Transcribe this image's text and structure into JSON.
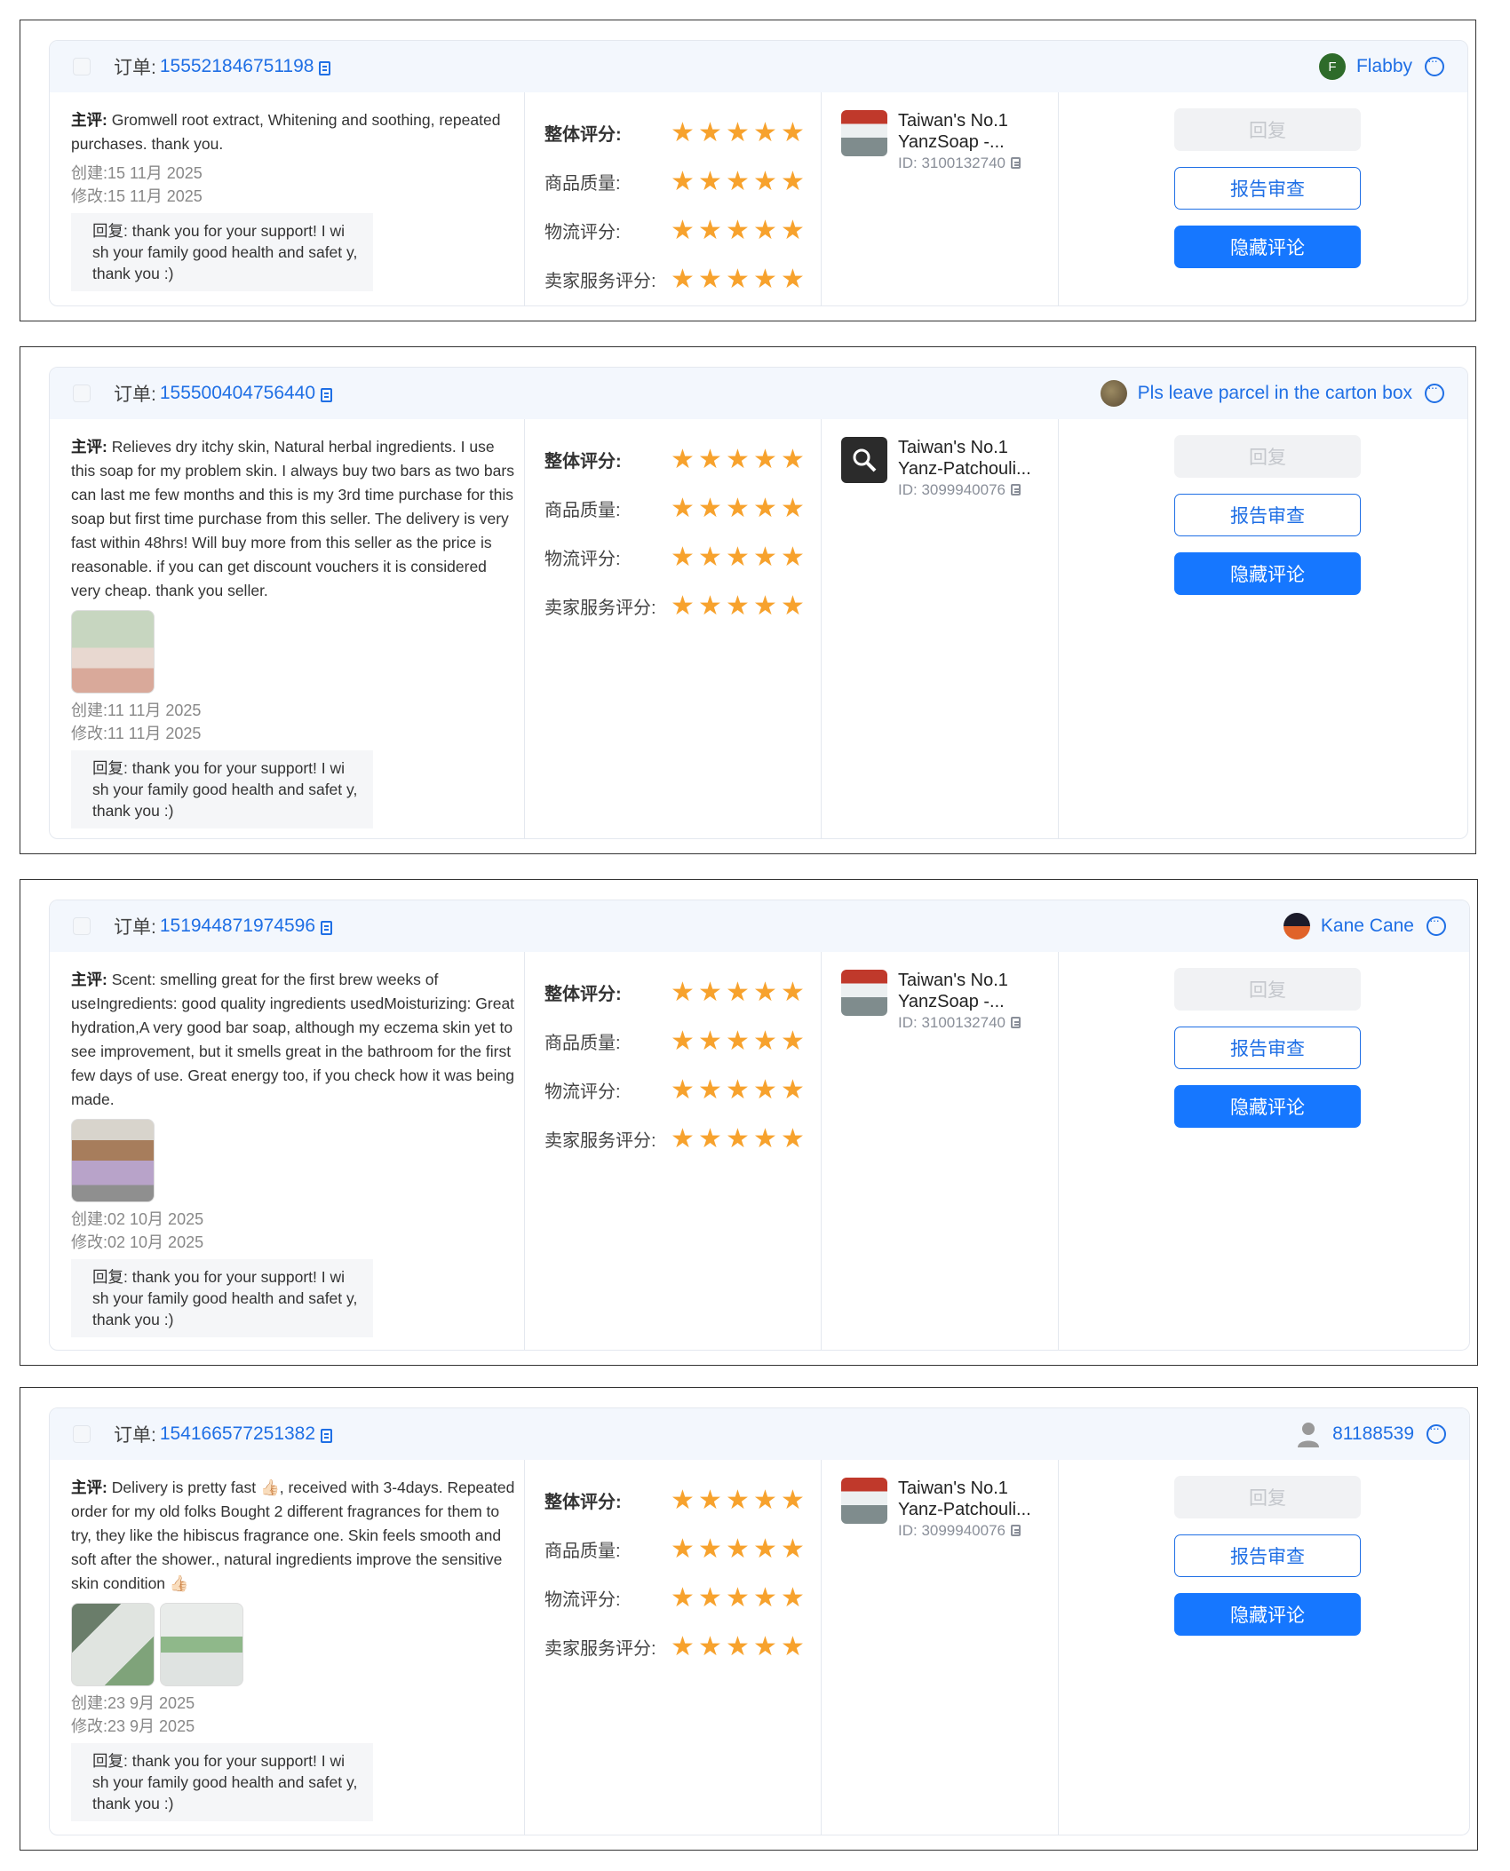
{
  "labels": {
    "order_prefix": "订单:",
    "main_review_prefix": "主评:",
    "created_prefix": "创建:",
    "modified_prefix": "修改:",
    "reply_prefix": "回复",
    "overall": "整体评分:",
    "quality": "商品质量:",
    "logistics": "物流评分:",
    "service": "卖家服务评分:",
    "btn_reply": "回复",
    "btn_report": "报告审查",
    "btn_hide": "隐藏评论",
    "star_glyph": "★"
  },
  "colors": {
    "accent": "#1677ff",
    "link": "#1f6fe5",
    "star": "#f7a22d",
    "header_bg": "#f3f7fd"
  },
  "reviews": [
    {
      "order_no": "155521846751198",
      "buyer": "Flabby",
      "buyer_avatar_letter": "F",
      "review": "Gromwell root extract, Whitening and soothing, repeated purchases. thank you.",
      "created": "15 11月 2025",
      "modified": "15 11月 2025",
      "reply": ": thank you for your support! I wi sh your family good health and safet y, thank you :)",
      "ratings": {
        "overall": 5,
        "quality": 5,
        "logistics": 5,
        "service": 5
      },
      "product_title_1": "Taiwan's No.1",
      "product_title_2": "YanzSoap -...",
      "product_id": "ID: 3100132740",
      "images": 0
    },
    {
      "order_no": "155500404756440",
      "buyer": "Pls leave parcel in the carton box",
      "buyer_avatar_letter": "",
      "review": "Relieves dry itchy skin, Natural herbal ingredients. I use this soap for my problem skin. I always buy two bars as two bars can last me few months and this is my 3rd time purchase for this soap but first time purchase from this seller. The delivery is very fast within 48hrs! Will buy more from this seller as the price is reasonable. if you can get discount vouchers it is considered very cheap. thank you seller.",
      "created": "11 11月 2025",
      "modified": "11 11月 2025",
      "reply": ": thank you for your support! I wi sh your family good health and safet y, thank you :)",
      "ratings": {
        "overall": 5,
        "quality": 5,
        "logistics": 5,
        "service": 5
      },
      "product_title_1": "Taiwan's No.1",
      "product_title_2": "Yanz-Patchouli...",
      "product_id": "ID: 3099940076",
      "images": 1
    },
    {
      "order_no": "151944871974596",
      "buyer": "Kane Cane",
      "buyer_avatar_letter": "",
      "review": "Scent: smelling great for the first brew weeks of useIngredients: good quality ingredients usedMoisturizing: Great hydration,A very good bar soap, although my eczema skin yet to see improvement, but it smells great in the bathroom for the first few days of use. Great energy too, if you check how it was being made.",
      "created": "02 10月 2025",
      "modified": "02 10月 2025",
      "reply": ": thank you for your support! I wi sh your family good health and safet y, thank you :)",
      "ratings": {
        "overall": 5,
        "quality": 5,
        "logistics": 5,
        "service": 5
      },
      "product_title_1": "Taiwan's No.1",
      "product_title_2": "YanzSoap -...",
      "product_id": "ID: 3100132740",
      "images": 1
    },
    {
      "order_no": "154166577251382",
      "buyer": "81188539",
      "buyer_avatar_letter": "",
      "review": "Delivery is pretty fast 👍🏻, received with 3-4days. Repeated order for my old folks Bought 2 different fragrances for them to try, they like the hibiscus fragrance one. Skin feels smooth and soft after the shower., natural ingredients improve the sensitive skin condition 👍🏻",
      "created": "23 9月 2025",
      "modified": "23 9月 2025",
      "reply": ": thank you for your support! I wi sh your family good health and safet y, thank you :)",
      "ratings": {
        "overall": 5,
        "quality": 5,
        "logistics": 5,
        "service": 5
      },
      "product_title_1": "Taiwan's No.1",
      "product_title_2": "Yanz-Patchouli...",
      "product_id": "ID: 3099940076",
      "images": 2
    }
  ]
}
